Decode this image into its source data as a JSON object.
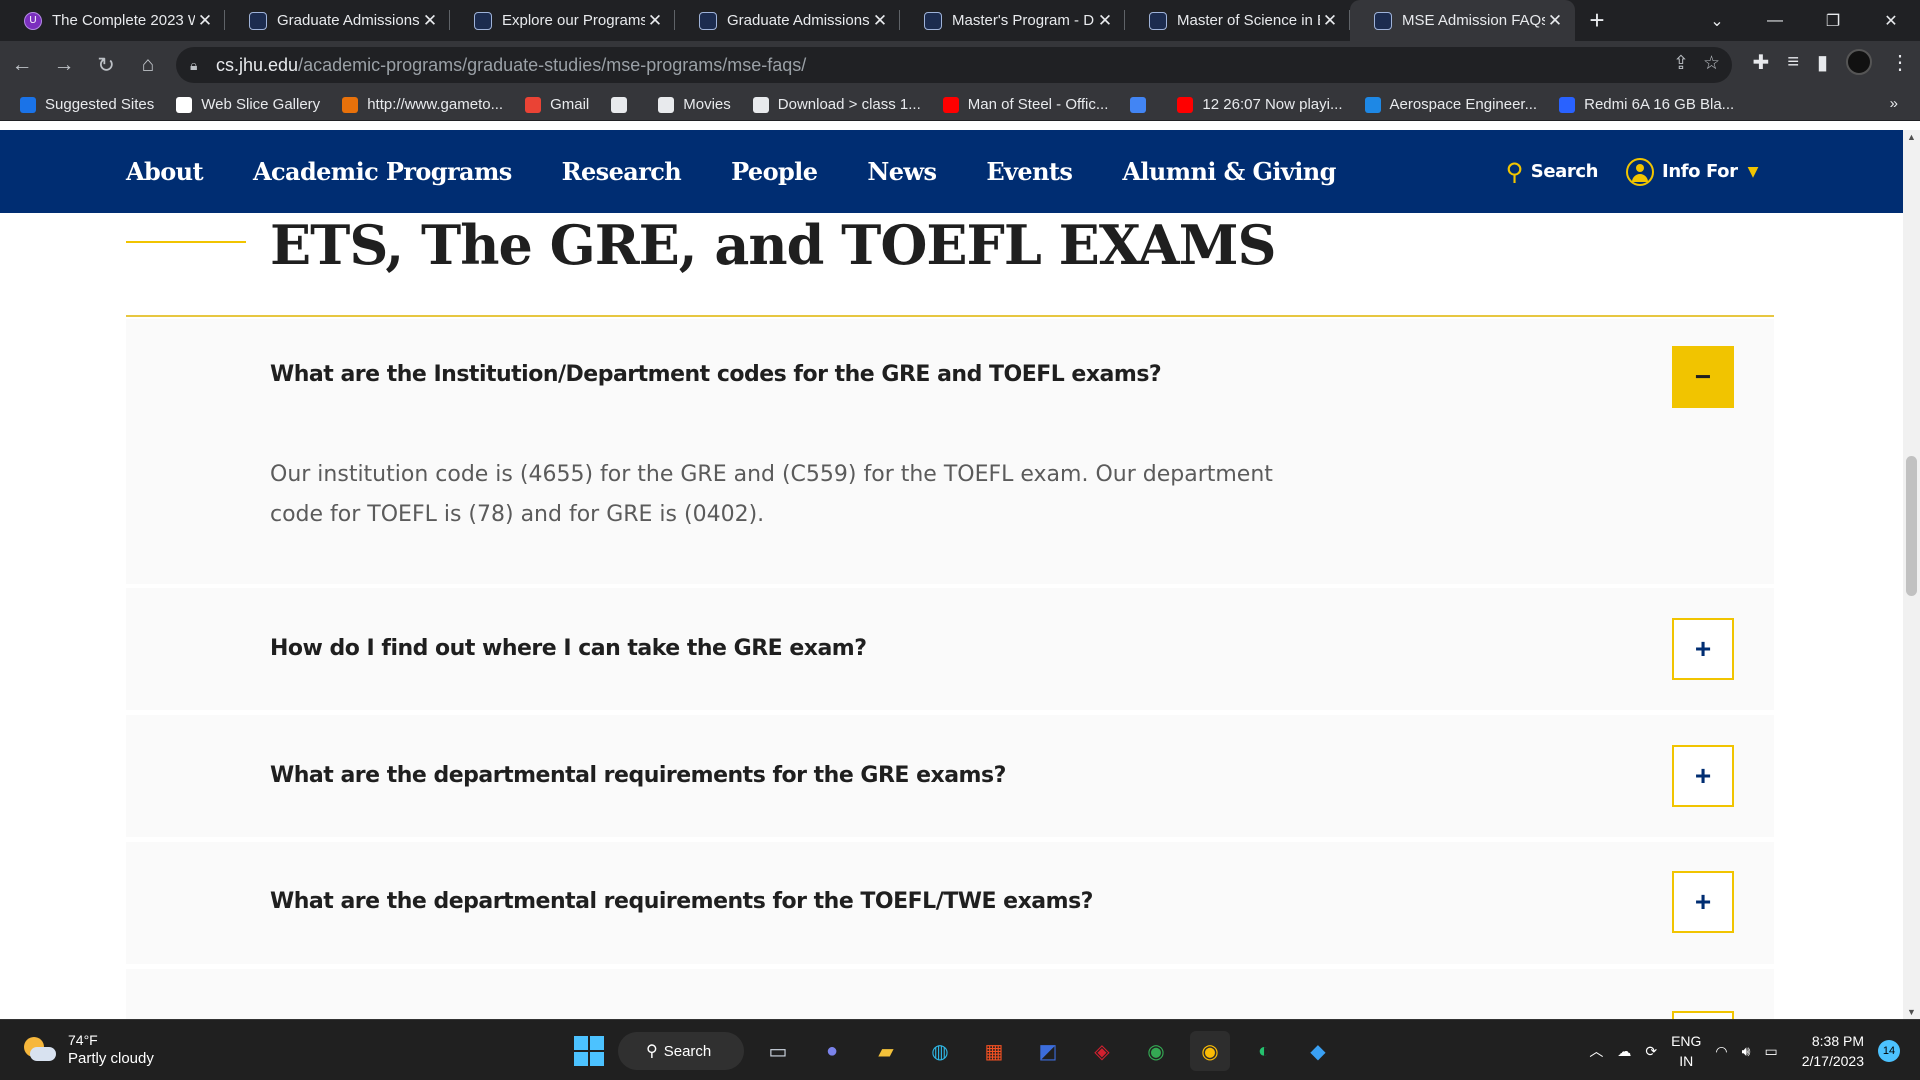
{
  "browser": {
    "tabs": [
      {
        "title": "The Complete 2023 W",
        "active": false
      },
      {
        "title": "Graduate Admissions",
        "active": false
      },
      {
        "title": "Explore our Programs",
        "active": false
      },
      {
        "title": "Graduate Admissions",
        "active": false
      },
      {
        "title": "Master's Program - D",
        "active": false
      },
      {
        "title": "Master of Science in E",
        "active": false
      },
      {
        "title": "MSE Admission FAQs",
        "active": true
      }
    ],
    "url_domain": "cs.jhu.edu",
    "url_path": "/academic-programs/graduate-studies/mse-programs/mse-faqs/",
    "bookmarks": [
      {
        "label": "Suggested Sites",
        "color": "#1a73e8"
      },
      {
        "label": "Web Slice Gallery",
        "color": "#ffffff"
      },
      {
        "label": "http://www.gameto...",
        "color": "#e8710a"
      },
      {
        "label": "Gmail",
        "color": "#ea4335"
      },
      {
        "label": "",
        "color": "#e8eaed"
      },
      {
        "label": "Movies",
        "color": "#e8eaed"
      },
      {
        "label": "Download > class 1...",
        "color": "#e8eaed"
      },
      {
        "label": "Man of Steel - Offic...",
        "color": "#ff0000"
      },
      {
        "label": "",
        "color": "#4285f4"
      },
      {
        "label": "12 26:07 Now playi...",
        "color": "#ff0000"
      },
      {
        "label": "Aerospace Engineer...",
        "color": "#1e88e5"
      },
      {
        "label": "Redmi 6A 16 GB Bla...",
        "color": "#2962ff"
      }
    ],
    "bookmarks_more": "»"
  },
  "site_nav": {
    "links": [
      "About",
      "Academic Programs",
      "Research",
      "People",
      "News",
      "Events",
      "Alumni & Giving"
    ],
    "search_label": "Search",
    "info_for_label": "Info For"
  },
  "section": {
    "heading": "ETS, The GRE, and TOEFL EXAMS"
  },
  "faqs": [
    {
      "question": "What are the Institution/Department codes for the GRE and TOEFL exams?",
      "answer_line1": "Our institution code is (4655) for the GRE and (C559) for the TOEFL exam. Our department",
      "answer_line2": "code for TOEFL is (78) and for GRE is (0402).",
      "expanded": true,
      "toggle": "−"
    },
    {
      "question": "How do I find out where I can take the GRE exam?",
      "expanded": false,
      "toggle": "+"
    },
    {
      "question": "What are the departmental requirements for the GRE exams?",
      "expanded": false,
      "toggle": "+"
    },
    {
      "question": "What are the departmental requirements for the TOEFL/TWE exams?",
      "expanded": false,
      "toggle": "+"
    }
  ],
  "taskbar": {
    "weather_temp": "74°F",
    "weather_desc": "Partly cloudy",
    "search_label": "Search",
    "lang_line1": "ENG",
    "lang_line2": "IN",
    "time": "8:38 PM",
    "date": "2/17/2023",
    "notification_count": "14"
  },
  "colors": {
    "jhu_blue": "#002d72",
    "jhu_gold": "#f1c400"
  }
}
